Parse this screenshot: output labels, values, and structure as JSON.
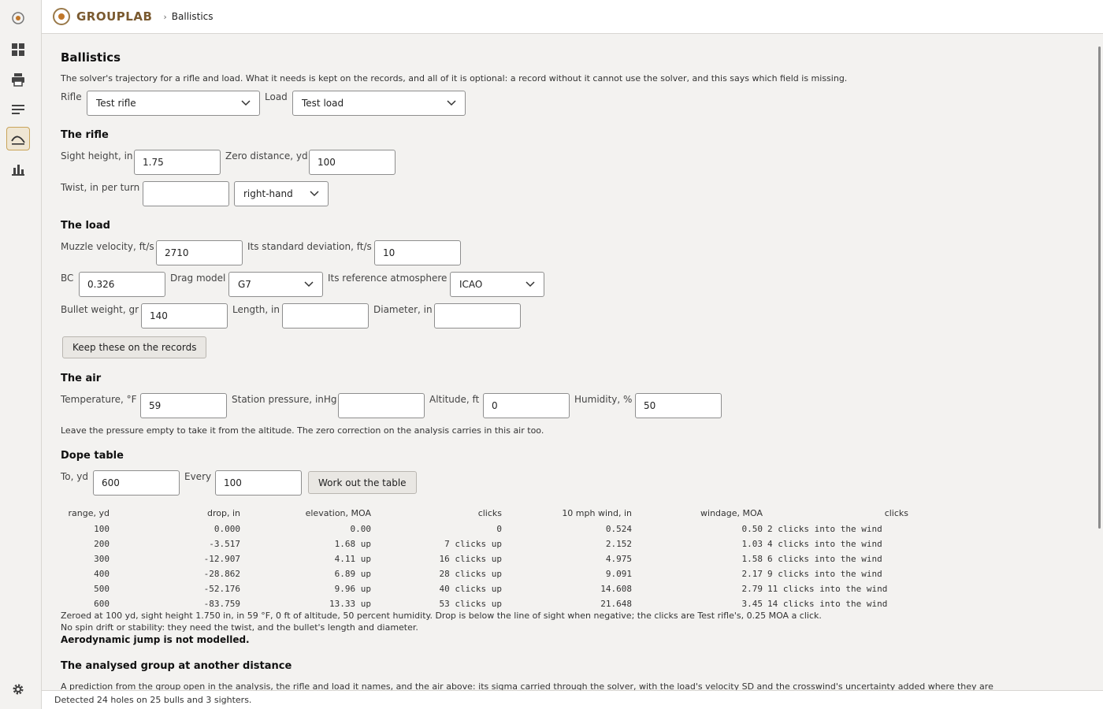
{
  "app": {
    "brand": "GROUPLAB",
    "breadcrumb_sep": "›",
    "breadcrumb": "Ballistics"
  },
  "sidebar": [
    "logo-icon",
    "dashboard-icon",
    "print-icon",
    "list-icon",
    "ballistics-icon",
    "chart-icon",
    "gear-icon"
  ],
  "page": {
    "title": "Ballistics",
    "intro": "The solver's trajectory for a rifle and load. What it needs is kept on the records, and all of it is optional: a record without it cannot use the solver, and this says which field is missing.",
    "rifle_label": "Rifle",
    "rifle_value": "Test rifle",
    "load_label": "Load",
    "load_value": "Test load"
  },
  "rifle": {
    "heading": "The rifle",
    "sight_height_label": "Sight height, in",
    "sight_height": "1.75",
    "zero_label": "Zero distance, yd",
    "zero": "100",
    "twist_label": "Twist, in per turn",
    "twist": "",
    "twist_dir": "right-hand"
  },
  "load": {
    "heading": "The load",
    "mv_label": "Muzzle velocity, ft/s",
    "mv": "2710",
    "sd_label": "Its standard deviation, ft/s",
    "sd": "10",
    "bc_label": "BC",
    "bc": "0.326",
    "drag_label": "Drag model",
    "drag": "G7",
    "atm_label": "Its reference atmosphere",
    "atm": "ICAO",
    "weight_label": "Bullet weight, gr",
    "weight": "140",
    "length_label": "Length, in",
    "length": "",
    "diameter_label": "Diameter, in",
    "diameter": "",
    "keep_button": "Keep these on the records"
  },
  "air": {
    "heading": "The air",
    "temp_label": "Temperature, °F",
    "temp": "59",
    "pressure_label": "Station pressure, inHg",
    "pressure": "",
    "alt_label": "Altitude, ft",
    "alt": "0",
    "humidity_label": "Humidity, %",
    "humidity": "50",
    "note": "Leave the pressure empty to take it from the altitude. The zero correction on the analysis carries in this air too."
  },
  "dope": {
    "heading": "Dope table",
    "to_label": "To, yd",
    "to": "600",
    "every_label": "Every",
    "every": "100",
    "work_button": "Work out the table",
    "headers": [
      "range, yd",
      "drop, in",
      "elevation, MOA",
      "clicks",
      "10 mph wind, in",
      "windage, MOA",
      "clicks"
    ],
    "rows": [
      [
        "100",
        "0.000",
        "0.00",
        "0",
        "0.524",
        "0.50",
        "2 clicks into the wind"
      ],
      [
        "200",
        "-3.517",
        "1.68 up",
        "7 clicks up",
        "2.152",
        "1.03",
        "4 clicks into the wind"
      ],
      [
        "300",
        "-12.907",
        "4.11 up",
        "16 clicks up",
        "4.975",
        "1.58",
        "6 clicks into the wind"
      ],
      [
        "400",
        "-28.862",
        "6.89 up",
        "28 clicks up",
        "9.091",
        "2.17",
        "9 clicks into the wind"
      ],
      [
        "500",
        "-52.176",
        "9.96 up",
        "40 clicks up",
        "14.608",
        "2.79",
        "11 clicks into the wind"
      ],
      [
        "600",
        "-83.759",
        "13.33 up",
        "53 clicks up",
        "21.648",
        "3.45",
        "14 clicks into the wind"
      ]
    ],
    "note1": "Zeroed at 100 yd, sight height 1.750 in, in 59 °F, 0 ft of altitude, 50 percent humidity. Drop is below the line of sight when negative; the clicks are Test rifle's, 0.25 MOA a click.",
    "note2": "No spin drift or stability: they need the twist, and the bullet's length and diameter.",
    "note3": "Aerodynamic jump is not modelled."
  },
  "group": {
    "heading": "The analysed group at another distance",
    "text": "A prediction from the group open in the analysis, the rifle and load it names, and the air above: its sigma carried through the solver, with the load's velocity SD and the crosswind's uncertainty added where they are"
  },
  "status": "Detected 24 holes on 25 bulls and 3 sighters."
}
